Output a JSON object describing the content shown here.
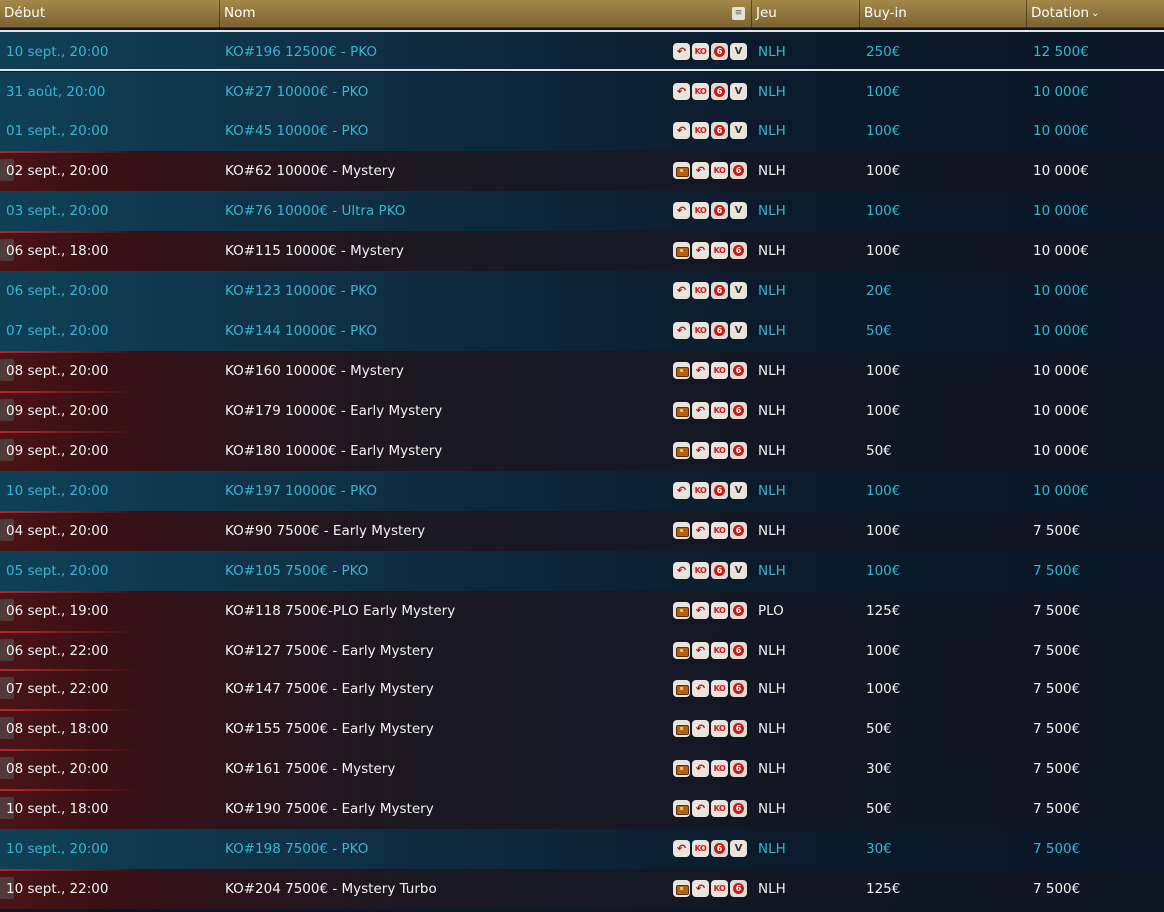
{
  "columns": {
    "debut": "Début",
    "nom": "Nom",
    "jeu": "Jeu",
    "buyin": "Buy-in",
    "dotation": "Dotation"
  },
  "icons": {
    "sort": "chevron-down-icon",
    "filter": "filter-icon",
    "rebuy": "rebuy-arrow-icon",
    "ko": "ko-icon",
    "six_max": "six-max-icon",
    "v": "variant-v-icon",
    "chest": "mystery-chest-icon"
  },
  "colors": {
    "pko_text": "#3ab5d0",
    "mystery_text": "#f2f2f2",
    "header_gold": "#a4884a"
  },
  "rows": [
    {
      "debut": "10 sept., 20:00",
      "nom": "KO#196 12500€ - PKO",
      "jeu": "NLH",
      "buyin": "250€",
      "dotation": "12 500€",
      "type": "pko",
      "highlight": true
    },
    {
      "debut": "31 août, 20:00",
      "nom": "KO#27 10000€ - PKO",
      "jeu": "NLH",
      "buyin": "100€",
      "dotation": "10 000€",
      "type": "pko"
    },
    {
      "debut": "01 sept., 20:00",
      "nom": "KO#45 10000€ - PKO",
      "jeu": "NLH",
      "buyin": "100€",
      "dotation": "10 000€",
      "type": "pko"
    },
    {
      "debut": "02 sept., 20:00",
      "nom": "KO#62 10000€ - Mystery",
      "jeu": "NLH",
      "buyin": "100€",
      "dotation": "10 000€",
      "type": "mystery"
    },
    {
      "debut": "03 sept., 20:00",
      "nom": "KO#76 10000€ - Ultra PKO",
      "jeu": "NLH",
      "buyin": "100€",
      "dotation": "10 000€",
      "type": "pko"
    },
    {
      "debut": "06 sept., 18:00",
      "nom": "KO#115 10000€ - Mystery",
      "jeu": "NLH",
      "buyin": "100€",
      "dotation": "10 000€",
      "type": "mystery"
    },
    {
      "debut": "06 sept., 20:00",
      "nom": "KO#123 10000€ - PKO",
      "jeu": "NLH",
      "buyin": "20€",
      "dotation": "10 000€",
      "type": "pko"
    },
    {
      "debut": "07 sept., 20:00",
      "nom": "KO#144 10000€ - PKO",
      "jeu": "NLH",
      "buyin": "50€",
      "dotation": "10 000€",
      "type": "pko"
    },
    {
      "debut": "08 sept., 20:00",
      "nom": "KO#160 10000€ - Mystery",
      "jeu": "NLH",
      "buyin": "100€",
      "dotation": "10 000€",
      "type": "mystery"
    },
    {
      "debut": "09 sept., 20:00",
      "nom": "KO#179 10000€ - Early Mystery",
      "jeu": "NLH",
      "buyin": "100€",
      "dotation": "10 000€",
      "type": "mystery"
    },
    {
      "debut": "09 sept., 20:00",
      "nom": "KO#180 10000€ - Early Mystery",
      "jeu": "NLH",
      "buyin": "50€",
      "dotation": "10 000€",
      "type": "mystery"
    },
    {
      "debut": "10 sept., 20:00",
      "nom": "KO#197 10000€ - PKO",
      "jeu": "NLH",
      "buyin": "100€",
      "dotation": "10 000€",
      "type": "pko"
    },
    {
      "debut": "04 sept., 20:00",
      "nom": "KO#90 7500€ - Early Mystery",
      "jeu": "NLH",
      "buyin": "100€",
      "dotation": "7 500€",
      "type": "mystery"
    },
    {
      "debut": "05 sept., 20:00",
      "nom": "KO#105 7500€ - PKO",
      "jeu": "NLH",
      "buyin": "100€",
      "dotation": "7 500€",
      "type": "pko"
    },
    {
      "debut": "06 sept., 19:00",
      "nom": "KO#118 7500€-PLO Early Mystery",
      "jeu": "PLO",
      "buyin": "125€",
      "dotation": "7 500€",
      "type": "mystery"
    },
    {
      "debut": "06 sept., 22:00",
      "nom": "KO#127 7500€ - Early Mystery",
      "jeu": "NLH",
      "buyin": "100€",
      "dotation": "7 500€",
      "type": "mystery"
    },
    {
      "debut": "07 sept., 22:00",
      "nom": "KO#147 7500€ - Early Mystery",
      "jeu": "NLH",
      "buyin": "100€",
      "dotation": "7 500€",
      "type": "mystery"
    },
    {
      "debut": "08 sept., 18:00",
      "nom": "KO#155 7500€ - Early Mystery",
      "jeu": "NLH",
      "buyin": "50€",
      "dotation": "7 500€",
      "type": "mystery"
    },
    {
      "debut": "08 sept., 20:00",
      "nom": "KO#161 7500€ - Mystery",
      "jeu": "NLH",
      "buyin": "30€",
      "dotation": "7 500€",
      "type": "mystery"
    },
    {
      "debut": "10 sept., 18:00",
      "nom": "KO#190 7500€ - Early Mystery",
      "jeu": "NLH",
      "buyin": "50€",
      "dotation": "7 500€",
      "type": "mystery"
    },
    {
      "debut": "10 sept., 20:00",
      "nom": "KO#198 7500€ - PKO",
      "jeu": "NLH",
      "buyin": "30€",
      "dotation": "7 500€",
      "type": "pko"
    },
    {
      "debut": "10 sept., 22:00",
      "nom": "KO#204 7500€ - Mystery Turbo",
      "jeu": "NLH",
      "buyin": "125€",
      "dotation": "7 500€",
      "type": "mystery"
    }
  ]
}
